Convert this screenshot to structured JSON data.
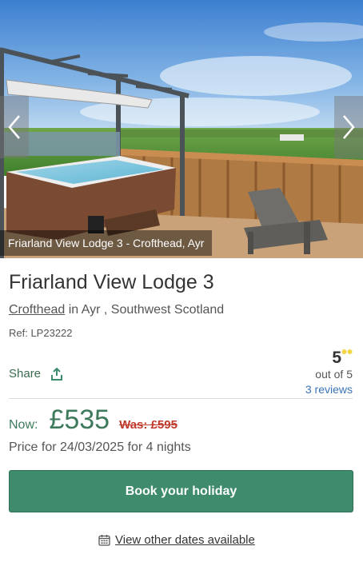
{
  "gallery": {
    "caption": "Friarland View Lodge 3 - Crofthead, Ayr",
    "prev_icon": "chevron-left-icon",
    "next_icon": "chevron-right-icon"
  },
  "property": {
    "title": "Friarland View Lodge 3",
    "location_link": "Crofthead",
    "location_rest": " in Ayr , Southwest Scotland",
    "ref": "Ref: LP23222"
  },
  "share": {
    "label": "Share",
    "icon": "share-icon"
  },
  "rating": {
    "score": "5",
    "out_of": "out of 5",
    "reviews": "3 reviews",
    "icon": "rating-dots-icon"
  },
  "pricing": {
    "now_label": "Now:",
    "price": "£535",
    "was": "Was: £595",
    "note": "Price for 24/03/2025 for 4 nights"
  },
  "actions": {
    "book_label": "Book your holiday",
    "other_dates_label": "View other dates available",
    "calendar_icon": "calendar-icon"
  },
  "colors": {
    "accent_green": "#3e8c6c",
    "price_green": "#3e7a5c",
    "was_red": "#c0392b",
    "link_blue": "#3a73b8"
  }
}
